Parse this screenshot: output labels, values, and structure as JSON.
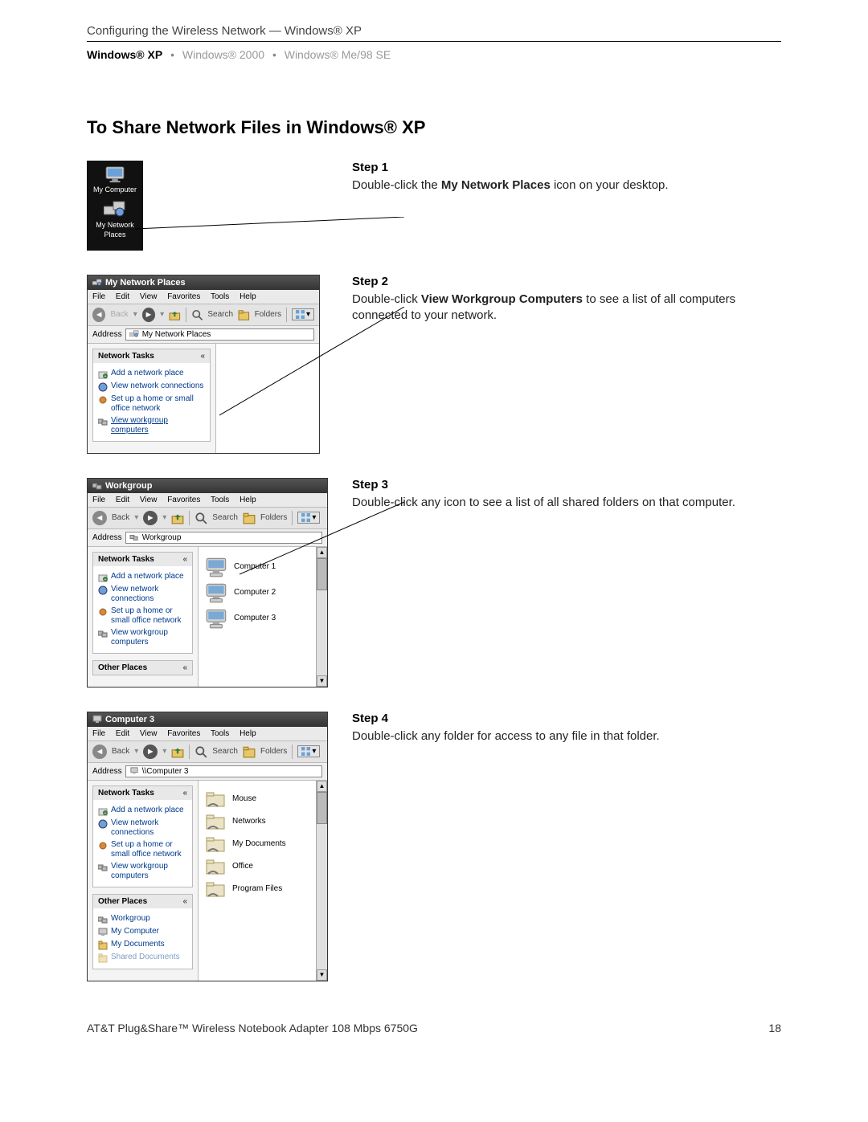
{
  "doc": {
    "header": "Configuring the Wireless Network — Windows® XP",
    "nav_active": "Windows® XP",
    "nav_2": "Windows® 2000",
    "nav_3": "Windows® Me/98 SE",
    "section_title": "To Share Network Files in Windows® XP",
    "footer_product": "AT&T Plug&Share™ Wireless Notebook Adapter 108 Mbps 6750G",
    "footer_page": "18"
  },
  "desktop": {
    "icon1": "My Computer",
    "icon2a": "My Network",
    "icon2b": "Places"
  },
  "menus": {
    "file": "File",
    "edit": "Edit",
    "view": "View",
    "fav": "Favorites",
    "tools": "Tools",
    "help": "Help"
  },
  "toolbar": {
    "back": "Back",
    "search": "Search",
    "folders": "Folders"
  },
  "address_label": "Address",
  "win2": {
    "title": "My Network Places",
    "addr": "My Network Places",
    "tasks_head": "Network Tasks",
    "t1": "Add a network place",
    "t2": "View network connections",
    "t3": "Set up a home or small office network",
    "t4": "View workgroup computers"
  },
  "win3": {
    "title": "Workgroup",
    "addr": "Workgroup",
    "tasks_head": "Network Tasks",
    "t1": "Add a network place",
    "t2": "View network connections",
    "t3": "Set up a home or small office network",
    "t4": "View workgroup computers",
    "other_head": "Other Places",
    "c1": "Computer 1",
    "c2": "Computer 2",
    "c3": "Computer 3"
  },
  "win4": {
    "title": "Computer 3",
    "addr": "\\\\Computer 3",
    "tasks_head": "Network Tasks",
    "t1": "Add a network place",
    "t2": "View network connections",
    "t3": "Set up a home or small office network",
    "t4": "View workgroup computers",
    "other_head": "Other Places",
    "op1": "Workgroup",
    "op2": "My Computer",
    "op3": "My Documents",
    "op4": "Shared Documents",
    "f1": "Mouse",
    "f2": "Networks",
    "f3": "My Documents",
    "f4": "Office",
    "f5": "Program Files"
  },
  "steps": {
    "s1_title": "Step 1",
    "s1_pre": "Double-click the ",
    "s1_bold": "My Network Places",
    "s1_post": " icon on your desktop.",
    "s2_title": "Step 2",
    "s2_pre": "Double-click ",
    "s2_bold": "View Workgroup Computers",
    "s2_post": " to see a list of all computers connected to your network.",
    "s3_title": "Step 3",
    "s3_body": "Double-click any icon to see a list of all shared folders on that computer.",
    "s4_title": "Step 4",
    "s4_body": "Double-click any folder for access to any file in that folder."
  }
}
